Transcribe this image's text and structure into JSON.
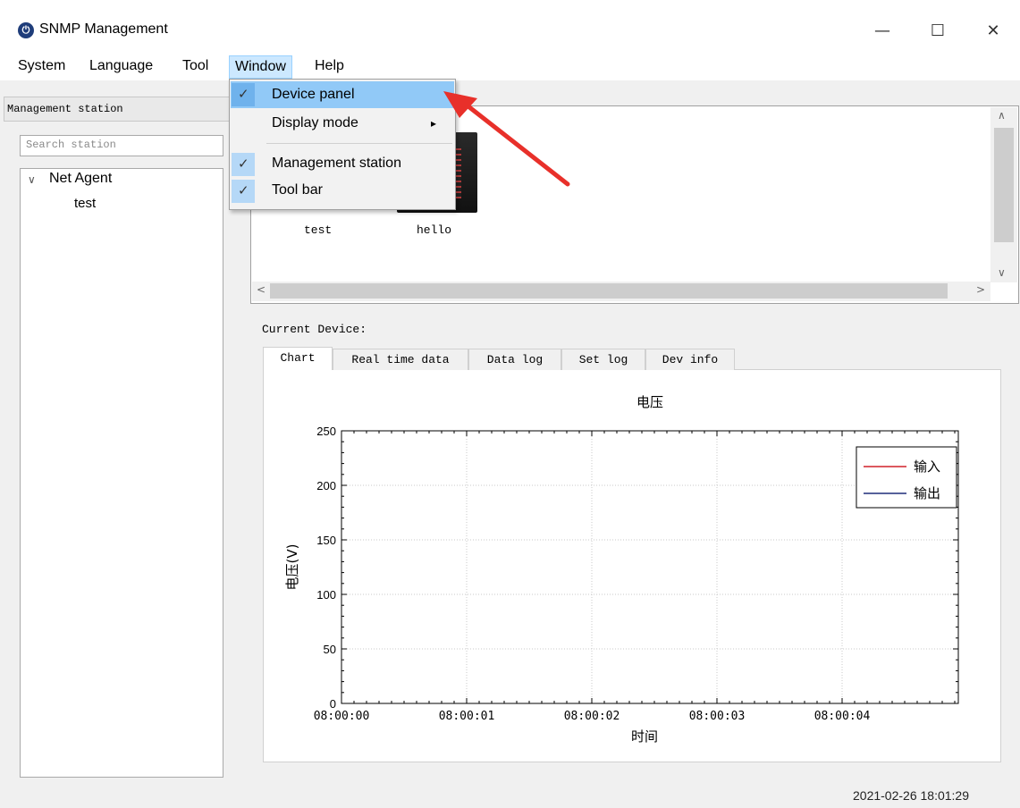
{
  "window": {
    "title": "SNMP Management",
    "minimize": "—",
    "maximize": "☐",
    "close": "✕"
  },
  "menubar": {
    "items": [
      "System",
      "Language",
      "Tool",
      "Window",
      "Help"
    ]
  },
  "window_menu": {
    "items": [
      {
        "label": "Device panel",
        "checked": true,
        "highlighted": true
      },
      {
        "label": "Display mode",
        "submenu": true
      },
      {
        "label": "Management station",
        "checked": true
      },
      {
        "label": "Tool bar",
        "checked": true
      }
    ],
    "check_glyph": "✓",
    "submenu_glyph": "▸"
  },
  "left_panel": {
    "header": "Management station",
    "search_placeholder": "Search station",
    "tree": {
      "root": "Net Agent",
      "children": [
        "test"
      ]
    }
  },
  "device_panel": {
    "devices": [
      "test",
      "hello"
    ]
  },
  "current_device_label": "Current Device:",
  "tabs": [
    "Chart",
    "Real time data",
    "Data log",
    "Set log",
    "Dev info"
  ],
  "chart_data": {
    "type": "line",
    "title": "电压",
    "xlabel": "时间",
    "ylabel": "电压(V)",
    "x_ticks": [
      "08:00:00",
      "08:00:01",
      "08:00:02",
      "08:00:03",
      "08:00:04"
    ],
    "y_ticks": [
      0,
      50,
      100,
      150,
      200,
      250
    ],
    "ylim": [
      0,
      250
    ],
    "grid": true,
    "legend_position": "top-right",
    "series": [
      {
        "name": "输入",
        "color": "#d0202a",
        "values": []
      },
      {
        "name": "输出",
        "color": "#1f2d7a",
        "values": []
      }
    ]
  },
  "status": {
    "datetime": "2021-02-26 18:01:29"
  },
  "colors": {
    "menu_highlight": "#91c9f7",
    "arrow": "#e8302a"
  }
}
